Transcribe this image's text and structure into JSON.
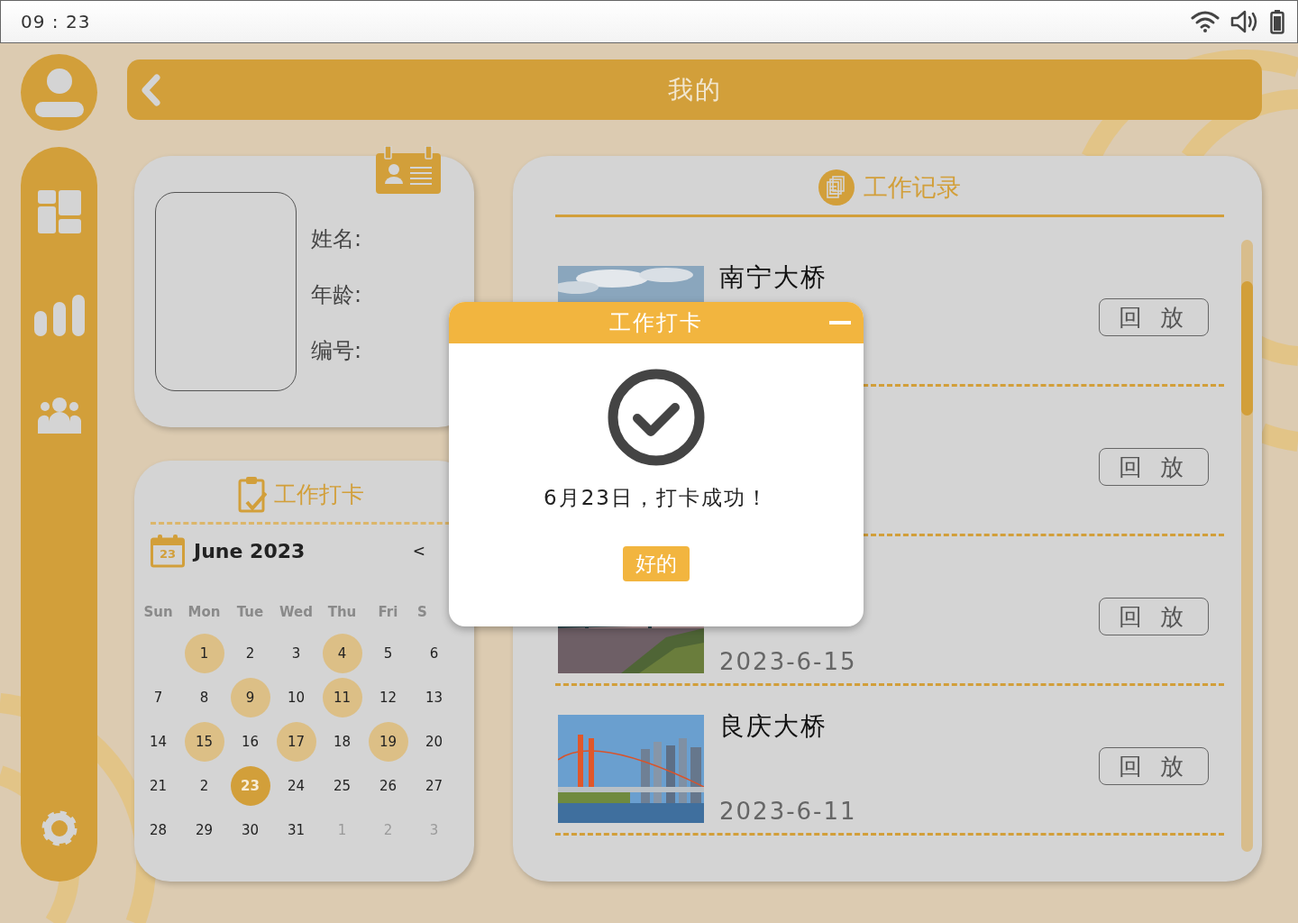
{
  "status_bar": {
    "time": "09 : 23"
  },
  "header": {
    "title": "我的"
  },
  "profile": {
    "fields": [
      "姓名:",
      "年龄:",
      "编号:"
    ]
  },
  "checkin_calendar": {
    "title": "工作打卡",
    "icon_date": "23",
    "month": "June 2023",
    "prev": "<",
    "weekdays": [
      "Sun",
      "Mon",
      "Tue",
      "Wed",
      "Thu",
      "Fri",
      "S"
    ],
    "weeks": [
      [
        {
          "day": "1",
          "checked": true,
          "selected": false,
          "muted": false
        },
        {
          "day": "2",
          "checked": false,
          "selected": false,
          "muted": false
        },
        {
          "day": "3",
          "checked": false,
          "selected": false,
          "muted": false
        },
        {
          "day": "4",
          "checked": true,
          "selected": false,
          "muted": false
        },
        {
          "day": "5",
          "checked": false,
          "selected": false,
          "muted": false
        },
        {
          "day": "6",
          "checked": false,
          "selected": false,
          "muted": false
        }
      ],
      [
        {
          "day": "7",
          "checked": false,
          "selected": false,
          "muted": false
        },
        {
          "day": "8",
          "checked": false,
          "selected": false,
          "muted": false
        },
        {
          "day": "9",
          "checked": true,
          "selected": false,
          "muted": false
        },
        {
          "day": "10",
          "checked": false,
          "selected": false,
          "muted": false
        },
        {
          "day": "11",
          "checked": true,
          "selected": false,
          "muted": false
        },
        {
          "day": "12",
          "checked": false,
          "selected": false,
          "muted": false
        },
        {
          "day": "13",
          "checked": false,
          "selected": false,
          "muted": false
        }
      ],
      [
        {
          "day": "14",
          "checked": false,
          "selected": false,
          "muted": false
        },
        {
          "day": "15",
          "checked": true,
          "selected": false,
          "muted": false
        },
        {
          "day": "16",
          "checked": false,
          "selected": false,
          "muted": false
        },
        {
          "day": "17",
          "checked": true,
          "selected": false,
          "muted": false
        },
        {
          "day": "18",
          "checked": false,
          "selected": false,
          "muted": false
        },
        {
          "day": "19",
          "checked": true,
          "selected": false,
          "muted": false
        },
        {
          "day": "20",
          "checked": false,
          "selected": false,
          "muted": false
        }
      ],
      [
        {
          "day": "21",
          "checked": false,
          "selected": false,
          "muted": false
        },
        {
          "day": "2",
          "checked": false,
          "selected": false,
          "muted": false
        },
        {
          "day": "23",
          "checked": false,
          "selected": true,
          "muted": false
        },
        {
          "day": "24",
          "checked": false,
          "selected": false,
          "muted": false
        },
        {
          "day": "25",
          "checked": false,
          "selected": false,
          "muted": false
        },
        {
          "day": "26",
          "checked": false,
          "selected": false,
          "muted": false
        },
        {
          "day": "27",
          "checked": false,
          "selected": false,
          "muted": false
        }
      ],
      [
        {
          "day": "28",
          "checked": false,
          "selected": false,
          "muted": false
        },
        {
          "day": "29",
          "checked": false,
          "selected": false,
          "muted": false
        },
        {
          "day": "30",
          "checked": false,
          "selected": false,
          "muted": false
        },
        {
          "day": "31",
          "checked": false,
          "selected": false,
          "muted": false
        },
        {
          "day": "1",
          "checked": false,
          "selected": false,
          "muted": true
        },
        {
          "day": "2",
          "checked": false,
          "selected": false,
          "muted": true
        },
        {
          "day": "3",
          "checked": false,
          "selected": false,
          "muted": true
        }
      ]
    ]
  },
  "work_records": {
    "title": "工作记录",
    "items": [
      {
        "title": "南宁大桥",
        "button": "回 放"
      },
      {
        "button": "回 放"
      },
      {
        "date": "2023-6-15",
        "button": "回 放"
      },
      {
        "title": "良庆大桥",
        "date": "2023-6-11",
        "button": "回 放"
      }
    ]
  },
  "dialog": {
    "title": "工作打卡",
    "message": "6月23日，打卡成功！",
    "button": "好的"
  }
}
